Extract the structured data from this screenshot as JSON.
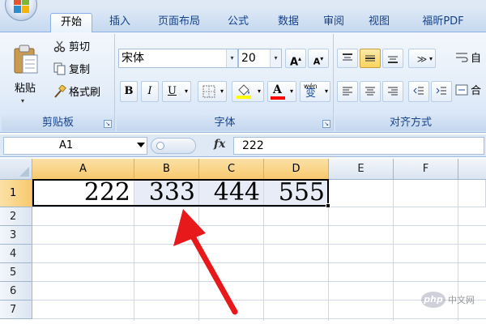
{
  "tabs": [
    "开始",
    "插入",
    "页面布局",
    "公式",
    "数据",
    "审阅",
    "视图",
    "福昕PDF"
  ],
  "clipboard": {
    "paste_label": "粘贴",
    "cut_label": "剪切",
    "copy_label": "复制",
    "format_painter_label": "格式刷",
    "group_label": "剪贴板"
  },
  "font": {
    "font_name": "宋体",
    "font_size": "20",
    "grow_label": "A",
    "shrink_label": "A",
    "bold_label": "B",
    "italic_label": "I",
    "underline_label": "U",
    "phonetic_label": "wén",
    "phonetic_char": "变",
    "group_label": "字体",
    "font_color": "#ff0000",
    "fill_color": "#ffff00"
  },
  "alignment": {
    "group_label": "对齐方式",
    "wrap_label": "自",
    "merge_label": "合"
  },
  "formula_bar": {
    "name_box": "A1",
    "fx": "fx",
    "value": "222"
  },
  "sheet": {
    "columns": [
      "A",
      "B",
      "C",
      "D",
      "E",
      "F"
    ],
    "rows": [
      "1",
      "2",
      "3",
      "4",
      "5",
      "6",
      "7"
    ],
    "row1_values": [
      "222",
      "333",
      "444",
      "555"
    ]
  },
  "annotation": {
    "arrow_color": "#e8191a"
  },
  "watermark": {
    "text": "php",
    "site": "中文网"
  }
}
